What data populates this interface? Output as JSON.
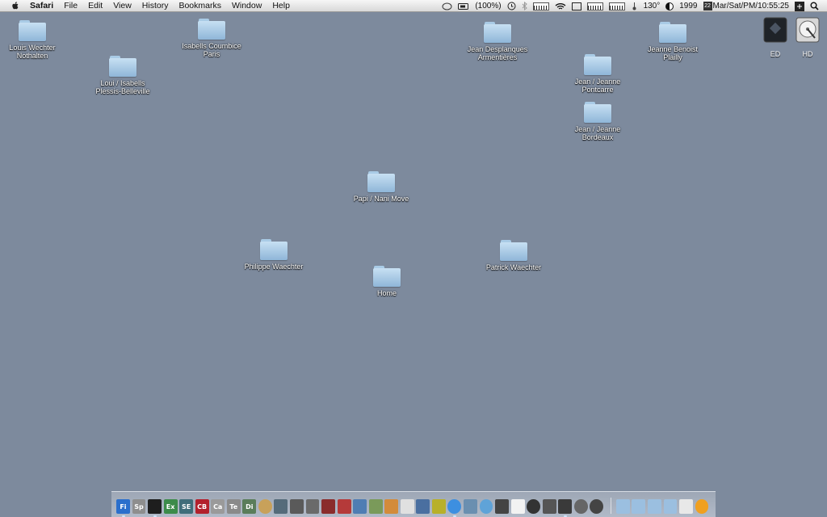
{
  "menubar": {
    "app": "Safari",
    "items": [
      "File",
      "Edit",
      "View",
      "History",
      "Bookmarks",
      "Window",
      "Help"
    ],
    "battery": "(100%)",
    "temperature": "130°",
    "year": "1999",
    "cal_day": "22",
    "clock": "Mar/Sat/PM/10:55:25"
  },
  "desktop_items": [
    {
      "label": "Louis Wechter\nNothalten"
    },
    {
      "label": "Isabells Coumbice\nParis"
    },
    {
      "label": "Loui / Isabells\nPlessis-Belleville"
    },
    {
      "label": "Jean Desplanques\nArmentières"
    },
    {
      "label": "Jeanne Benoist\nPlailly"
    },
    {
      "label": "Jean / Jeanne\nPontcarre"
    },
    {
      "label": "Jean / Jeanne\nBordeaux"
    },
    {
      "label": "Papi / Nani Move"
    },
    {
      "label": "Philippe Waechter"
    },
    {
      "label": "Patrick Waechter"
    },
    {
      "label": "Home"
    }
  ],
  "drives": [
    {
      "label": "ED"
    },
    {
      "label": "HD"
    }
  ],
  "dock": {
    "badges": [
      "Fi",
      "Sp",
      "",
      "Ex",
      "SE",
      "CB",
      "Ca",
      "Te",
      "Di"
    ],
    "badge_colors": [
      "#2b6fcc",
      "#8e8e8e",
      "#1e1e1e",
      "#3c8b4a",
      "#3f6d7a",
      "#b3202c",
      "#9a9a9a",
      "#8a8a8a",
      "#5a7d5a"
    ]
  }
}
